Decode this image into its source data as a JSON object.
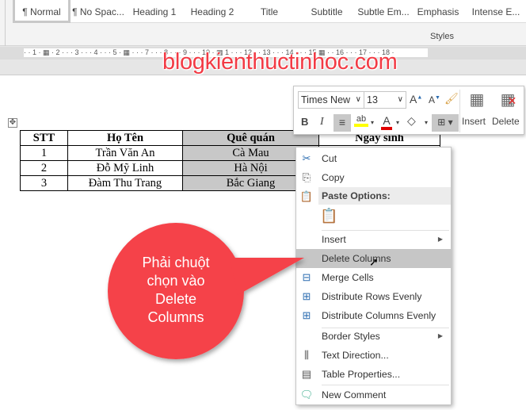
{
  "ribbon": {
    "styles": [
      "¶ Normal",
      "¶ No Spac...",
      "Heading 1",
      "Heading 2",
      "Title",
      "Subtitle",
      "Subtle Em...",
      "Emphasis",
      "Intense E..."
    ],
    "group_label": "Styles"
  },
  "ruler": {
    "text": "· · 1 · ▦ · 2 · · · 3 · · · 4 · · · 5 · ▦ · · · 7 · · · 8 · · · 9 · · · 10 · ▦ 1 · · · 12 · · 13 · · · 14 · · · 15 ▦ · · 16 · · · 17 · · · 18 ·"
  },
  "watermark": "blogkienthuctinhoc.com",
  "table": {
    "headers": [
      "STT",
      "Họ Tên",
      "Quê quán",
      "Ngày sinh"
    ],
    "rows": [
      [
        "1",
        "Trần Văn An",
        "Cà Mau",
        ""
      ],
      [
        "2",
        "Đỗ Mỹ Linh",
        "Hà Nội",
        ""
      ],
      [
        "3",
        "Đàm Thu Trang",
        "Bắc Giang",
        ""
      ]
    ]
  },
  "mini_toolbar": {
    "font": "Times New",
    "size": "13",
    "insert_label": "Insert",
    "delete_label": "Delete",
    "highlight_color": "#ffff00",
    "font_color": "#e00000"
  },
  "context_menu": {
    "items": {
      "cut": "Cut",
      "copy": "Copy",
      "paste_options": "Paste Options:",
      "insert": "Insert",
      "delete_columns": "Delete Columns",
      "merge_cells": "Merge Cells",
      "distribute_rows": "Distribute Rows Evenly",
      "distribute_columns": "Distribute Columns Evenly",
      "border_styles": "Border Styles",
      "text_direction": "Text Direction...",
      "table_properties": "Table Properties...",
      "new_comment": "New Comment"
    }
  },
  "callout": {
    "lines": [
      "Phải chuột",
      "chọn vào",
      "Delete",
      "Columns"
    ],
    "color": "#f5424a"
  }
}
